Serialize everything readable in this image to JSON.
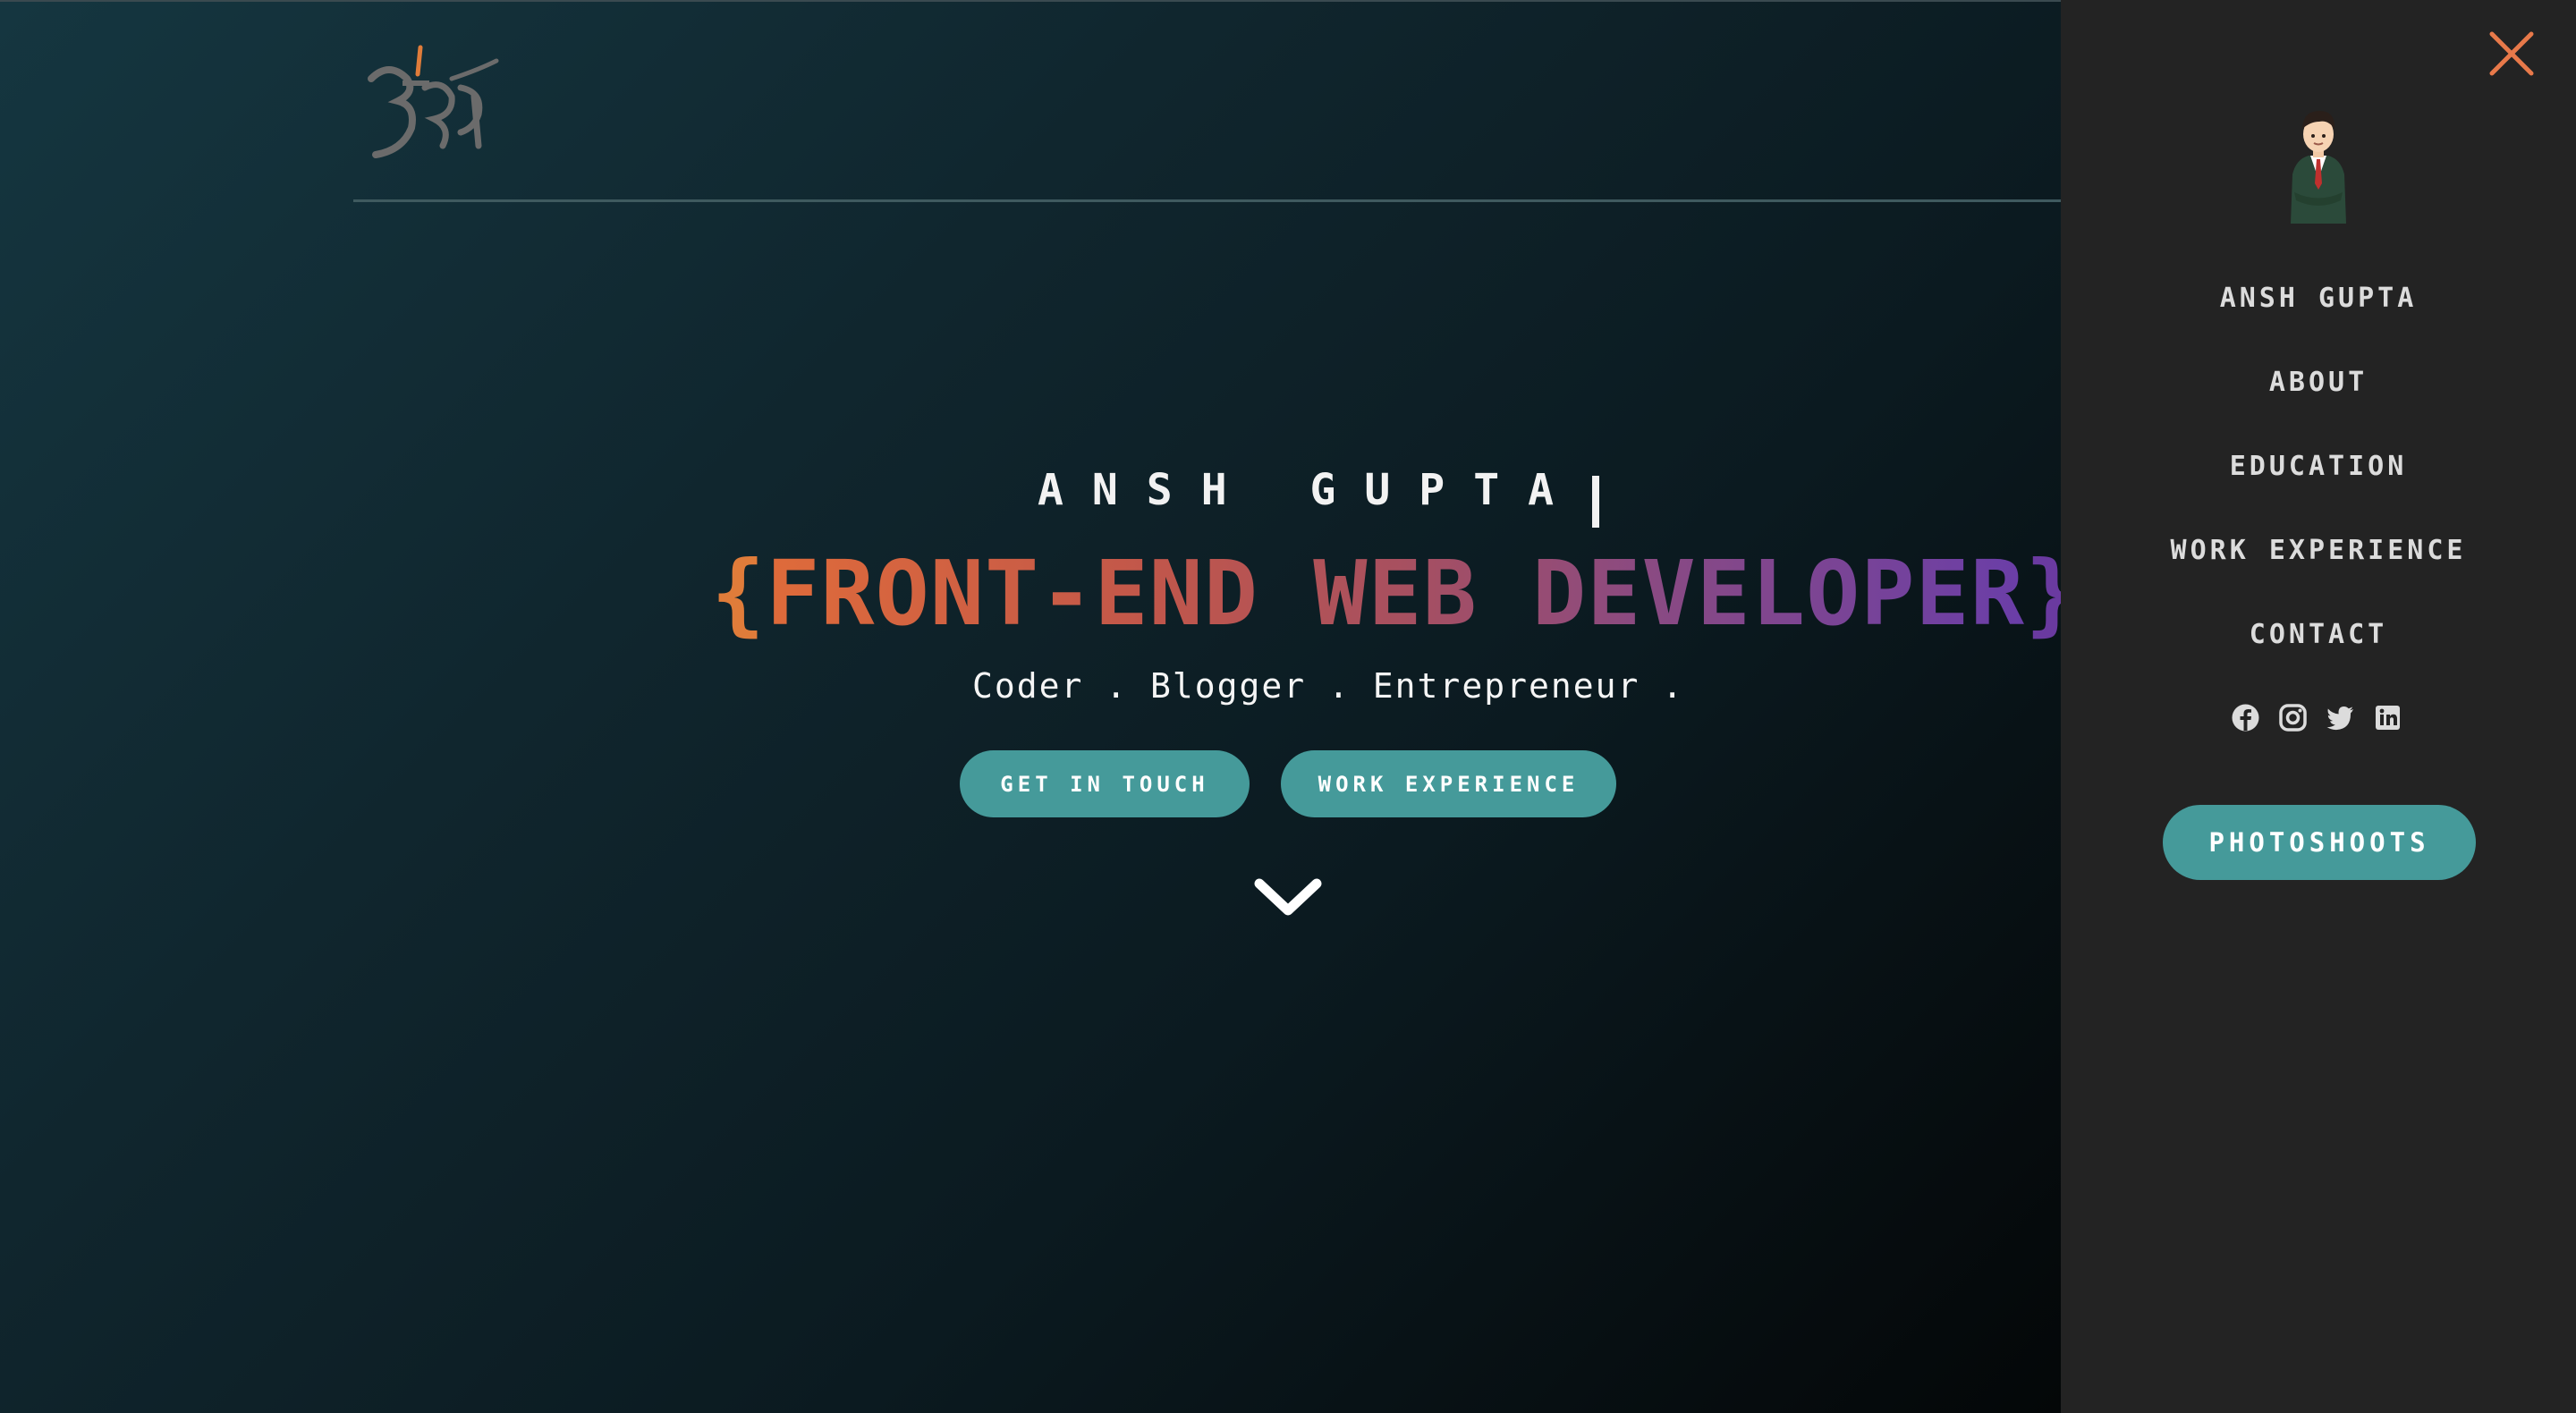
{
  "hero": {
    "name": "ANSH GUPTA",
    "title_open": "{",
    "title_text": "FRONT-END WEB DEVELOPER",
    "title_close": "}",
    "tagline": "Coder . Blogger . Entrepreneur .",
    "buttons": {
      "get_in_touch": "GET IN TOUCH",
      "work_experience": "WORK EXPERIENCE"
    },
    "scroll_icon": "chevron-down-icon"
  },
  "logo": {
    "text": "अंश",
    "icon": "logo-signature"
  },
  "sidebar": {
    "close_icon": "close-icon",
    "avatar_icon": "avatar",
    "items": [
      {
        "label": "ANSH GUPTA"
      },
      {
        "label": "ABOUT"
      },
      {
        "label": "EDUCATION"
      },
      {
        "label": "WORK EXPERIENCE"
      },
      {
        "label": "CONTACT"
      }
    ],
    "socials": [
      "facebook-icon",
      "instagram-icon",
      "twitter-icon",
      "linkedin-icon"
    ],
    "photoshoots_label": "PHOTOSHOOTS"
  },
  "colors": {
    "accent": "#459a9a",
    "orange": "#e07c3a",
    "purple": "#6a3aa0",
    "panel_bg": "#232323",
    "close_icon": "#e8794a"
  }
}
